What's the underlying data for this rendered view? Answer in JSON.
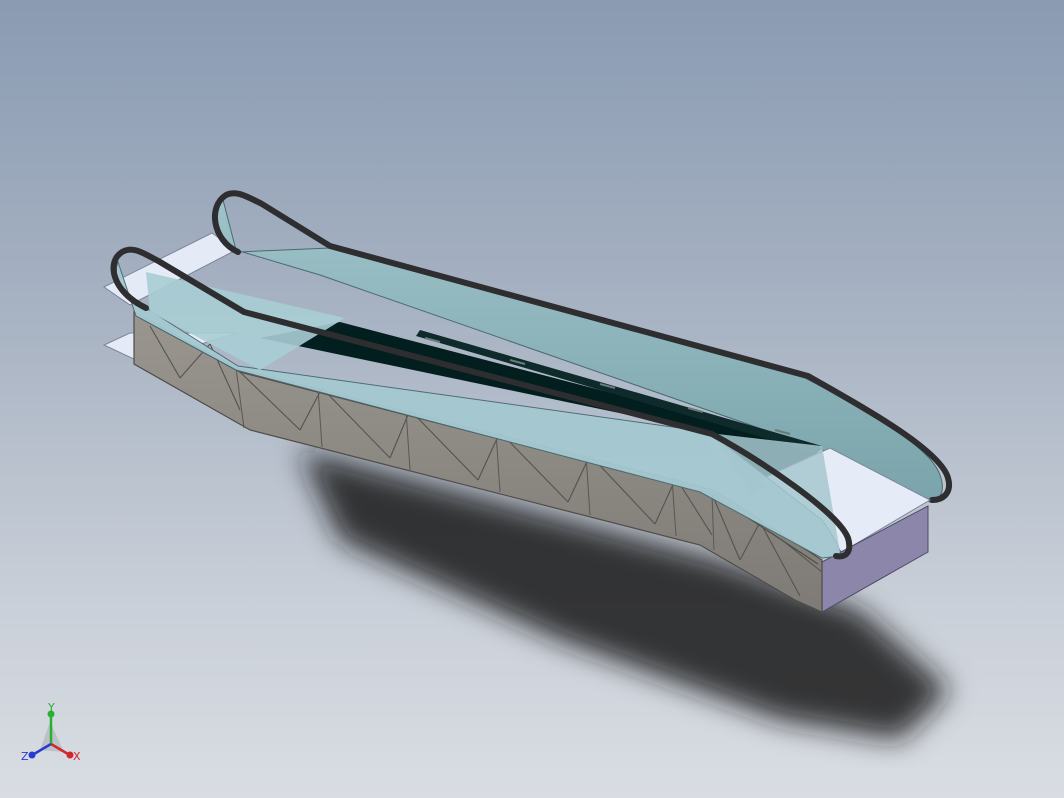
{
  "viewport": {
    "background_top": "#8a9bb2",
    "background_bottom": "#d9dde3"
  },
  "model": {
    "type": "escalator-assembly",
    "colors": {
      "truss": "#8d8a84",
      "truss_lines": "#55534f",
      "glass_balustrade": "#8fb6bd",
      "handrail": "#2f2f30",
      "step_band": "#02201f",
      "landing_plate": "#e6ecf7",
      "end_box": "#8a85a8",
      "shadow": "#101214"
    }
  },
  "triad": {
    "x_label": "X",
    "y_label": "Y",
    "z_label": "Z",
    "x_color": "#d0282a",
    "y_color": "#28b030",
    "z_color": "#2a3ad0"
  }
}
